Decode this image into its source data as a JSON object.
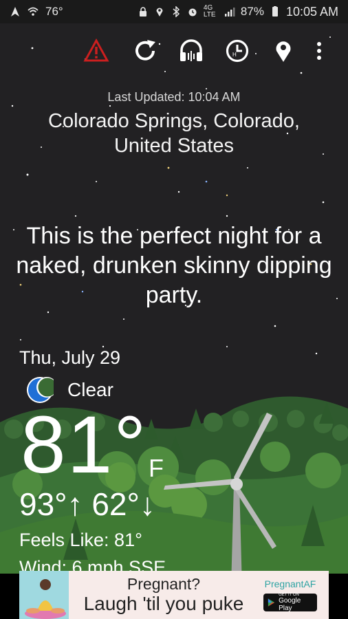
{
  "status_bar": {
    "temperature": "76°",
    "network": "4G LTE",
    "battery": "87%",
    "time": "10:05 AM"
  },
  "toolbar": {
    "items": [
      "alert-icon",
      "refresh-icon",
      "sound-icon",
      "history-icon",
      "location-icon",
      "more-icon"
    ],
    "alert_color": "#cc1f1f"
  },
  "weather": {
    "last_updated": "Last Updated: 10:04 AM",
    "location": "Colorado Springs, Colorado, United States",
    "quip": "This is the perfect night for a naked, drunken skinny dipping party.",
    "date": "Thu, July 29",
    "condition": "Clear",
    "temperature": "81°",
    "unit": "F",
    "high_low": "93°↑ 62°↓",
    "feels_like": "Feels Like:  81°",
    "wind": "Wind:  6 mph SSE"
  },
  "ad": {
    "line1": "Pregnant?",
    "line2": "Laugh 'til you puke",
    "brand": "PregnantAF",
    "store_small": "GET IT ON",
    "store_big": "Google Play"
  },
  "colors": {
    "sky": "#222123",
    "moon": "#1f6fd6",
    "hills": "#3e7a3a"
  }
}
